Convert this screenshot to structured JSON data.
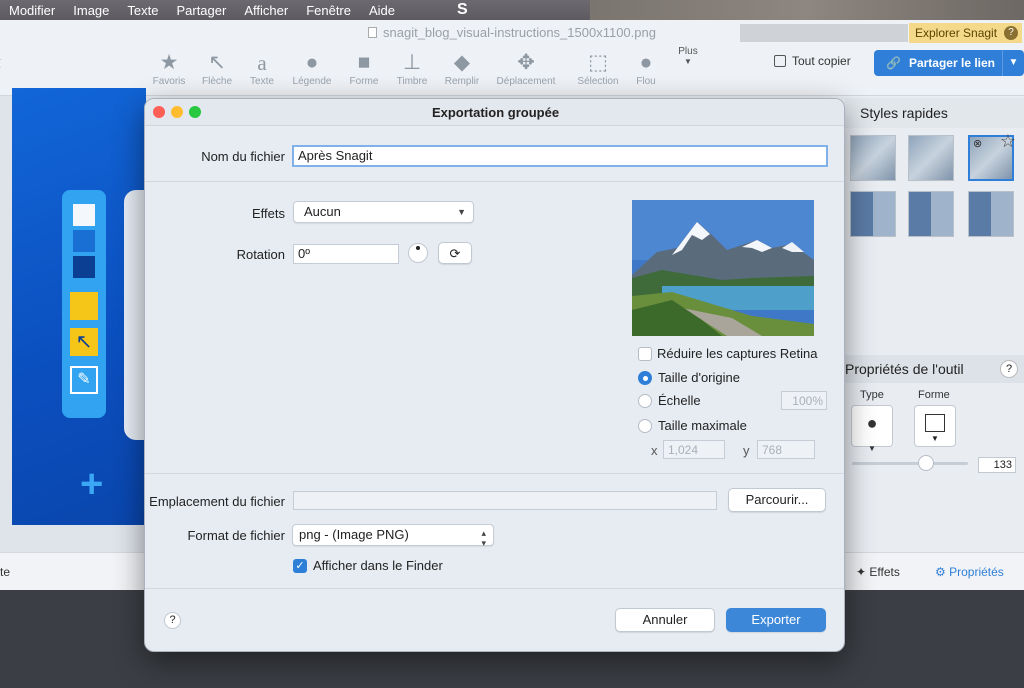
{
  "menubar": {
    "items": [
      "Modifier",
      "Image",
      "Texte",
      "Partager",
      "Afficher",
      "Fenêtre",
      "Aide"
    ],
    "app_logo": "S"
  },
  "window": {
    "title": "snagit_blog_visual-instructions_1500x1100.png",
    "explore_label": "Explorer Snagit",
    "explore_help": "?"
  },
  "toolbar": {
    "tools": [
      "Favoris",
      "Flèche",
      "Texte",
      "Légende",
      "Forme",
      "Timbre",
      "Remplir",
      "Déplacement",
      "Sélection",
      "Flou"
    ],
    "more_label": "Plus",
    "copy_all_label": "Tout copier",
    "share_label": "Partager le lien"
  },
  "bottombar": {
    "left_label": "te",
    "effects_label": "Effets",
    "properties_label": "Propriétés"
  },
  "right_panel": {
    "styles_title": "Styles rapides",
    "props_title": "Propriétés de l'outil",
    "props_help": "?",
    "type_label": "Type",
    "shape_label": "Forme",
    "slider_value": "133"
  },
  "dialog": {
    "title": "Exportation groupée",
    "filename_label": "Nom du fichier",
    "filename_value": "Après Snagit",
    "effects_label": "Effets",
    "effects_value": "Aucun",
    "rotation_label": "Rotation",
    "rotation_value": "0º",
    "retina_label": "Réduire les captures Retina",
    "size_original_label": "Taille d'origine",
    "scale_label": "Échelle",
    "scale_value": "100%",
    "max_size_label": "Taille maximale",
    "x_label": "x",
    "x_value": "1,024",
    "y_label": "y",
    "y_value": "768",
    "location_label": "Emplacement du fichier",
    "location_value": "",
    "browse_label": "Parcourir...",
    "format_label": "Format de fichier",
    "format_value": "png - (Image PNG)",
    "show_finder_label": "Afficher dans le Finder",
    "help": "?",
    "cancel_label": "Annuler",
    "export_label": "Exporter",
    "retina_checked": false,
    "size_mode": "original",
    "show_finder_checked": true
  },
  "colors": {
    "accent": "#2f7fd8",
    "artboard_blue": "#0b4fbf",
    "highlight_yellow": "#f5d98a"
  }
}
